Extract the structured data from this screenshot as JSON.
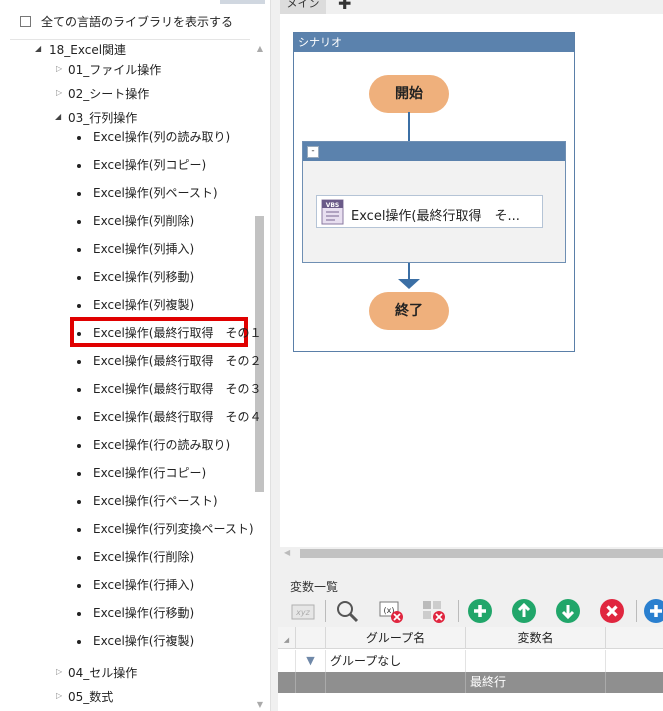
{
  "library_panel": {
    "show_all_label": "全ての言語のライブラリを表示する",
    "show_all_checked": false,
    "tree": {
      "root": {
        "label": "18_Excel関連"
      },
      "folder_file": {
        "label": "01_ファイル操作"
      },
      "folder_sheet": {
        "label": "02_シート操作"
      },
      "folder_rowcol": {
        "label": "03_行列操作"
      },
      "items": [
        "Excel操作(列の読み取り)",
        "Excel操作(列コピー)",
        "Excel操作(列ペースト)",
        "Excel操作(列削除)",
        "Excel操作(列挿入)",
        "Excel操作(列移動)",
        "Excel操作(列複製)",
        "Excel操作(最終行取得　その１",
        "Excel操作(最終行取得　その２",
        "Excel操作(最終行取得　その３",
        "Excel操作(最終行取得　その４",
        "Excel操作(行の読み取り)",
        "Excel操作(行コピー)",
        "Excel操作(行ペースト)",
        "Excel操作(行列変換ペースト)",
        "Excel操作(行削除)",
        "Excel操作(行挿入)",
        "Excel操作(行移動)",
        "Excel操作(行複製)"
      ],
      "folder_cell": {
        "label": "04_セル操作"
      },
      "folder_formula": {
        "label": "05_数式"
      }
    }
  },
  "tabs": {
    "main": "メイン",
    "add": "✚"
  },
  "workflow": {
    "scenario_title": "シナリオ",
    "start_label": "開始",
    "end_label": "終了",
    "sequence_collapse": "-",
    "activity_label": "Excel操作(最終行取得　そ...",
    "activity_icon_text": "VBS"
  },
  "variables": {
    "title": "変数一覧",
    "columns": [
      "グループ名",
      "変数名"
    ],
    "group_row": "グループなし",
    "var_row": "最終行"
  },
  "colors": {
    "accent_blue": "#5b82ad",
    "pill": "#efb07c",
    "highlight": "#e00000",
    "add_green": "#21a66a",
    "delete_red": "#e0263f"
  }
}
